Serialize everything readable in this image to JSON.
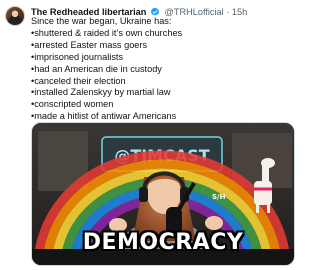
{
  "tweet": {
    "author_name": "The Redheaded libertarian",
    "handle": "@TRHLofficial",
    "separator": "·",
    "time": "15h",
    "lines": [
      "Since the war began, Ukraine has:",
      "•shuttered & raided it’s own churches",
      "•arrested Easter mass goers",
      "•imprisoned journalists",
      "•had an American die in custody",
      "•canceled their election",
      "•installed Zalenskyy by martial law",
      "•conscripted women",
      "•made a hitlist of antiwar Americans"
    ]
  },
  "media": {
    "banner_text": "@TIMCAST",
    "mic_label": "S/H",
    "caption": "DEMOCRACY"
  },
  "colors": {
    "verified": "#1d9bf0",
    "secondary_text": "#536471",
    "border": "#cfd9de"
  }
}
